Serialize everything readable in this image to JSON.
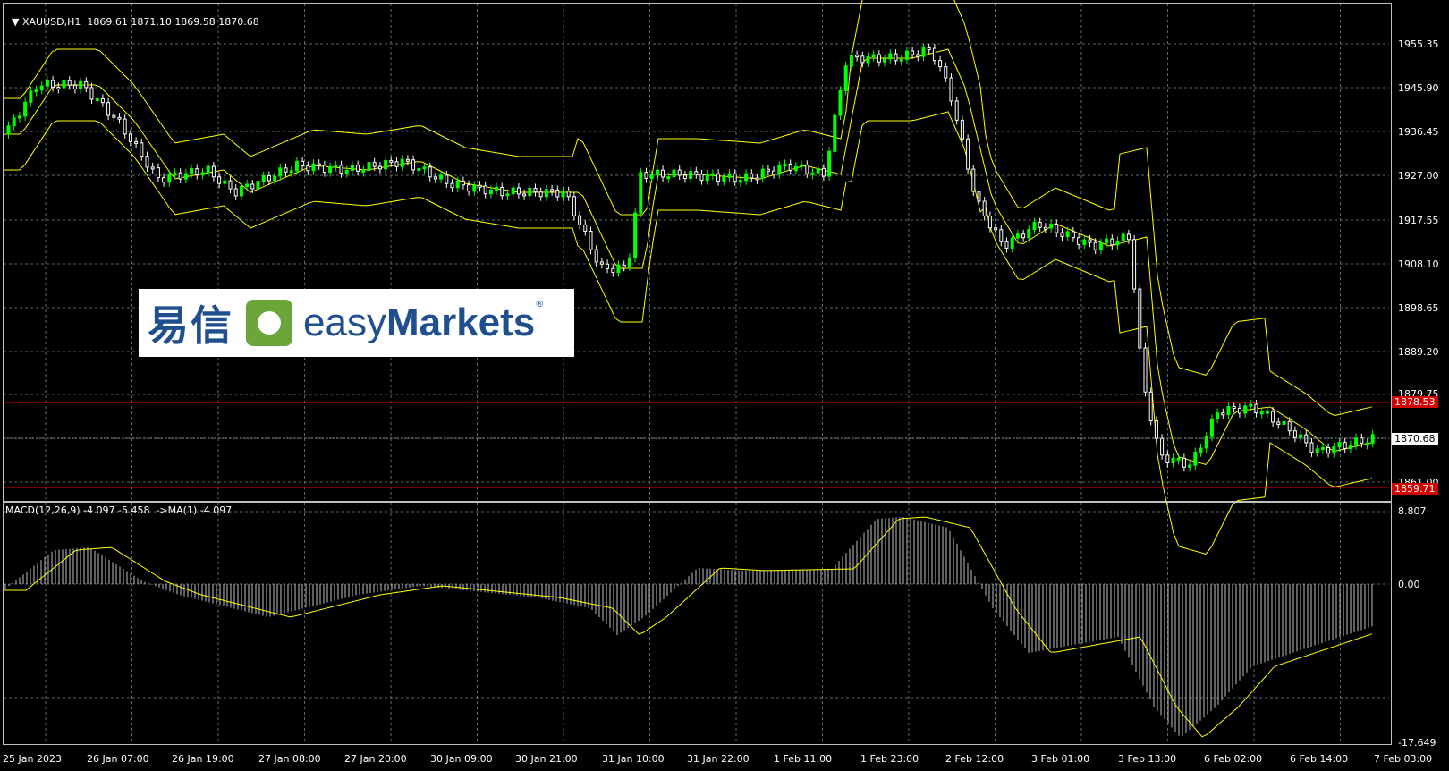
{
  "chart": {
    "symbol_header": "XAUUSD,H1  1869.61 1871.10 1869.58 1870.68",
    "price_levels": [
      "1955.35",
      "1945.90",
      "1936.45",
      "1927.00",
      "1917.55",
      "1908.10",
      "1898.65",
      "1889.20",
      "1879.75",
      "1861.00"
    ],
    "tags": {
      "resistance": "1878.53",
      "current": "1870.68",
      "support": "1859.71"
    },
    "macd_header": "MACD(12,26,9) -4.097 -5.458  ->MA(1) -4.097",
    "macd_levels": [
      "8.807",
      "0.00",
      "-17.649"
    ],
    "time_labels": [
      "25 Jan 2023",
      "26 Jan 07:00",
      "26 Jan 19:00",
      "27 Jan 08:00",
      "27 Jan 20:00",
      "30 Jan 09:00",
      "30 Jan 21:00",
      "31 Jan 10:00",
      "31 Jan 22:00",
      "1 Feb 11:00",
      "1 Feb 23:00",
      "2 Feb 12:00",
      "3 Feb 01:00",
      "3 Feb 13:00",
      "6 Feb 02:00",
      "6 Feb 14:00",
      "7 Feb 03:00"
    ],
    "colors": {
      "bull": "#00ff00",
      "bear": "#ffffff",
      "band": "#ffff00",
      "grid": "#5a6a6a",
      "level": "#e00000",
      "histogram": "#c0c0c0"
    }
  },
  "watermark": {
    "cn": "易信",
    "brand_light": "easy",
    "brand_bold": "Markets",
    "reg": "®"
  }
}
